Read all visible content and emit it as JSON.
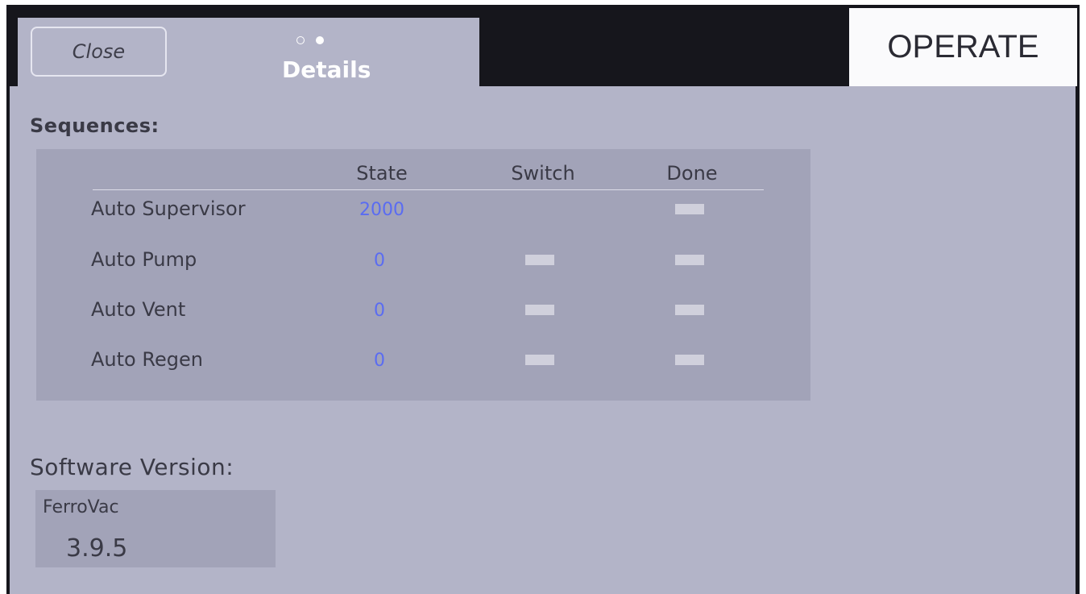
{
  "header": {
    "close_label": "Close",
    "title": "Details",
    "operate_label": "OPERATE",
    "page_dots": [
      "empty",
      "filled"
    ]
  },
  "sequences": {
    "label": "Sequences:",
    "columns": [
      "State",
      "Switch",
      "Done"
    ],
    "rows": [
      {
        "name": "Auto Supervisor",
        "state": "2000",
        "switch_indicator": false,
        "done_indicator": true
      },
      {
        "name": "Auto Pump",
        "state": "0",
        "switch_indicator": true,
        "done_indicator": true
      },
      {
        "name": "Auto Vent",
        "state": "0",
        "switch_indicator": true,
        "done_indicator": true
      },
      {
        "name": "Auto Regen",
        "state": "0",
        "switch_indicator": true,
        "done_indicator": true
      }
    ]
  },
  "software": {
    "label": "Software Version:",
    "name": "FerroVac",
    "version": "3.9.5"
  },
  "colors": {
    "panel": "#b3b4c8",
    "table_bg": "#a2a3b8",
    "state_value": "#5a6cf2",
    "indicator": "#d0d0dc",
    "bezel": "#16161c"
  }
}
